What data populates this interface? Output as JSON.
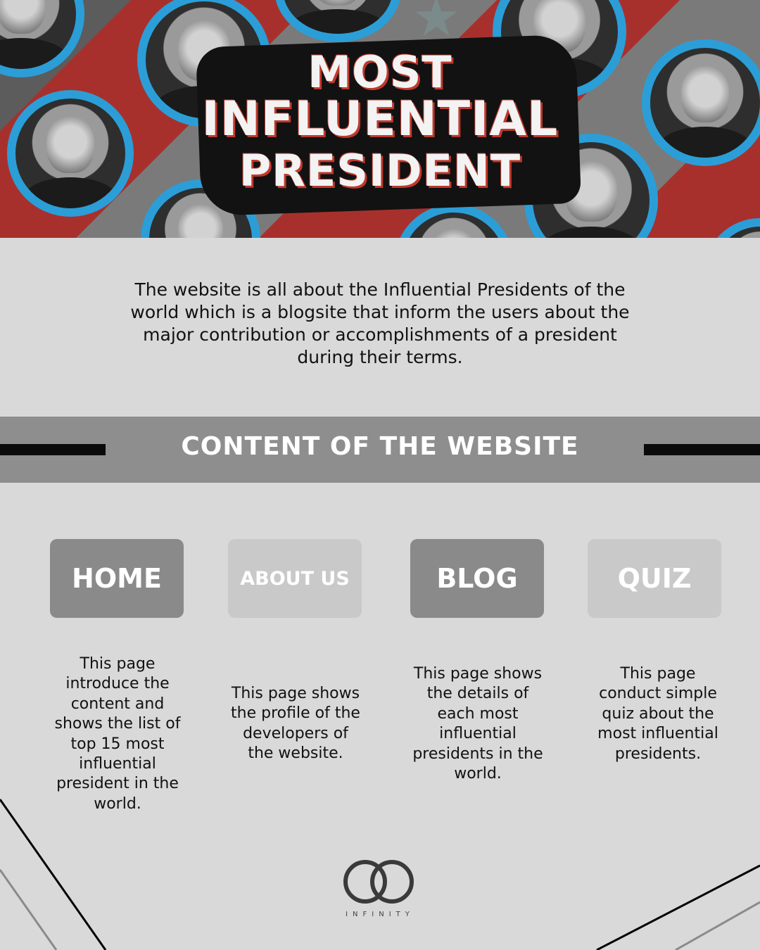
{
  "hero": {
    "title_line1": "MOST",
    "title_line2": "INFLUENTIAL",
    "title_line3": "PRESIDENT"
  },
  "intro": {
    "text": "The website is all about the Influential Presidents of the world which is a blogsite that inform the users about the major contribution or accomplishments of a president during their terms."
  },
  "banner": {
    "title": "CONTENT OF THE WEBSITE"
  },
  "pages": [
    {
      "label": "HOME",
      "description": "This page introduce the content and shows the list of top 15 most influential president in the world."
    },
    {
      "label": "ABOUT US",
      "description": "This page shows the profile of the developers of the website."
    },
    {
      "label": "BLOG",
      "description": "This page shows the details of each most influential presidents in the world."
    },
    {
      "label": "QUIZ",
      "description": "This page conduct simple quiz about the most influential presidents."
    }
  ],
  "logo": {
    "text": "INFINITY"
  },
  "colors": {
    "background": "#d9d9d9",
    "banner": "#8e8e8e",
    "button_dark": "#8a8a8a",
    "button_light": "#c9c9c9",
    "hero_ring": "#2b9ed8",
    "hero_accent": "#c0392b"
  }
}
